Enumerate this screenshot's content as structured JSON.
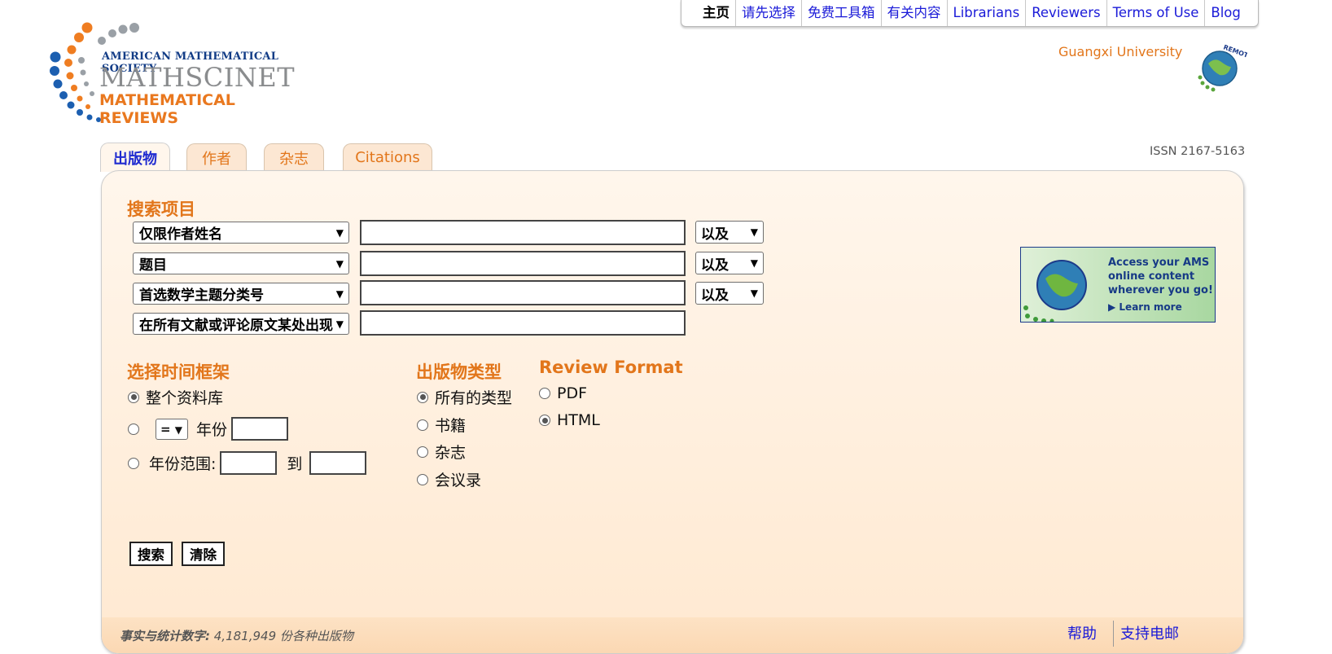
{
  "topnav": {
    "items": [
      "主页",
      "请先选择",
      "免费工具箱",
      "有关内容",
      "Librarians",
      "Reviewers",
      "Terms of Use",
      "Blog"
    ]
  },
  "logo": {
    "org": "AMERICAN MATHEMATICAL SOCIETY",
    "product": "MATHSCINET",
    "subtitle": "MATHEMATICAL REVIEWS"
  },
  "institution": "Guangxi University",
  "badge_text": "REMOTE ACCESS",
  "issn": "ISSN 2167-5163",
  "tabs": [
    "出版物",
    "作者",
    "杂志",
    "Citations"
  ],
  "search": {
    "section_title": "搜索项目",
    "fields": [
      {
        "field": "仅限作者姓名",
        "value": "",
        "operator": "以及"
      },
      {
        "field": "题目",
        "value": "",
        "operator": "以及"
      },
      {
        "field": "首选数学主题分类号",
        "value": "",
        "operator": "以及"
      },
      {
        "field": "在所有文献或评论原文某处出现",
        "value": ""
      }
    ]
  },
  "timeframe": {
    "title": "选择时间框架",
    "all_label": "整个资料库",
    "year_op": "=",
    "year_label": "年份",
    "range_label": "年份范围:",
    "to_label": "到"
  },
  "pubtype": {
    "title": "出版物类型",
    "options": [
      "所有的类型",
      "书籍",
      "杂志",
      "会议录"
    ],
    "selected": 0
  },
  "review_format": {
    "title": "Review Format",
    "options": [
      "PDF",
      "HTML"
    ],
    "selected": 1
  },
  "buttons": {
    "search": "搜索",
    "clear": "清除"
  },
  "ad": {
    "lines": [
      "Access your AMS",
      "online content",
      "wherever you go!"
    ],
    "learn_more": "Learn more",
    "badge": "REMOTE ACCESS"
  },
  "footer": {
    "facts_label": "事实与统计数字:",
    "facts_value": " 4,181,949 份各种出版物",
    "help": "帮助",
    "support": "支持电邮"
  },
  "colors": {
    "accent": "#e2761b",
    "link": "#1a1ad8",
    "brand_blue": "#123c86"
  }
}
